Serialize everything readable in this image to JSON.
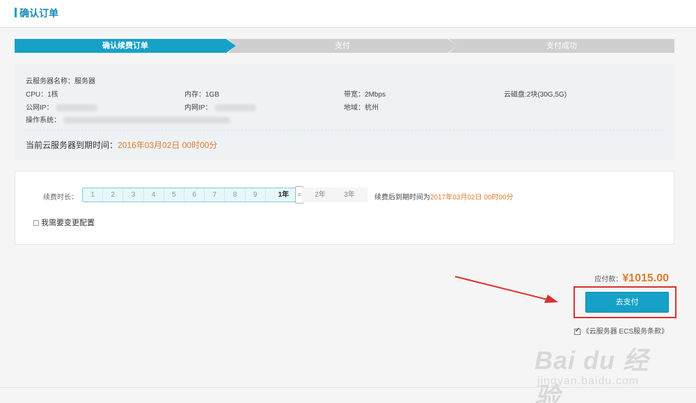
{
  "header": {
    "title": "确认订单"
  },
  "steps": [
    "确认续费订单",
    "支付",
    "支付成功"
  ],
  "server": {
    "name_label": "云服务器名称：",
    "name_value": "服务器",
    "cpu_label": "CPU：",
    "cpu_value": "1核",
    "memory_label": "内存：",
    "memory_value": "1GB",
    "bandwidth_label": "带宽：",
    "bandwidth_value": "2Mbps",
    "disk_label": "云磁盘:",
    "disk_value": "2块(30G,5G)",
    "public_ip_label": "公网IP：",
    "private_ip_label": "内网IP：",
    "region_label": "地域：",
    "region_value": "杭州",
    "os_label": "操作系统："
  },
  "expire": {
    "label": "当前云服务器到期时间：",
    "date": "2016年03月02日 00时00分"
  },
  "renew": {
    "duration_label": "续费时长：",
    "months": [
      "1",
      "2",
      "3",
      "4",
      "5",
      "6",
      "7",
      "8",
      "9",
      "1年"
    ],
    "selected_index": 9,
    "year_options": [
      "2年",
      "3年"
    ],
    "after_label": "续费后到期时间为",
    "after_date": "2017年03月02日 00时00分",
    "change_config_label": "我需要变更配置"
  },
  "payment": {
    "amount_label": "应付款：",
    "amount_value": "¥1015.00",
    "pay_button": "去支付",
    "agreement": "《云服务器 ECS服务条款》"
  },
  "watermark": {
    "brand": "Bai du 经验",
    "url": "jingyan.baidu.com"
  },
  "colors": {
    "accent": "#16a1c8",
    "price": "#e07a2e",
    "highlight": "#d9302c"
  }
}
